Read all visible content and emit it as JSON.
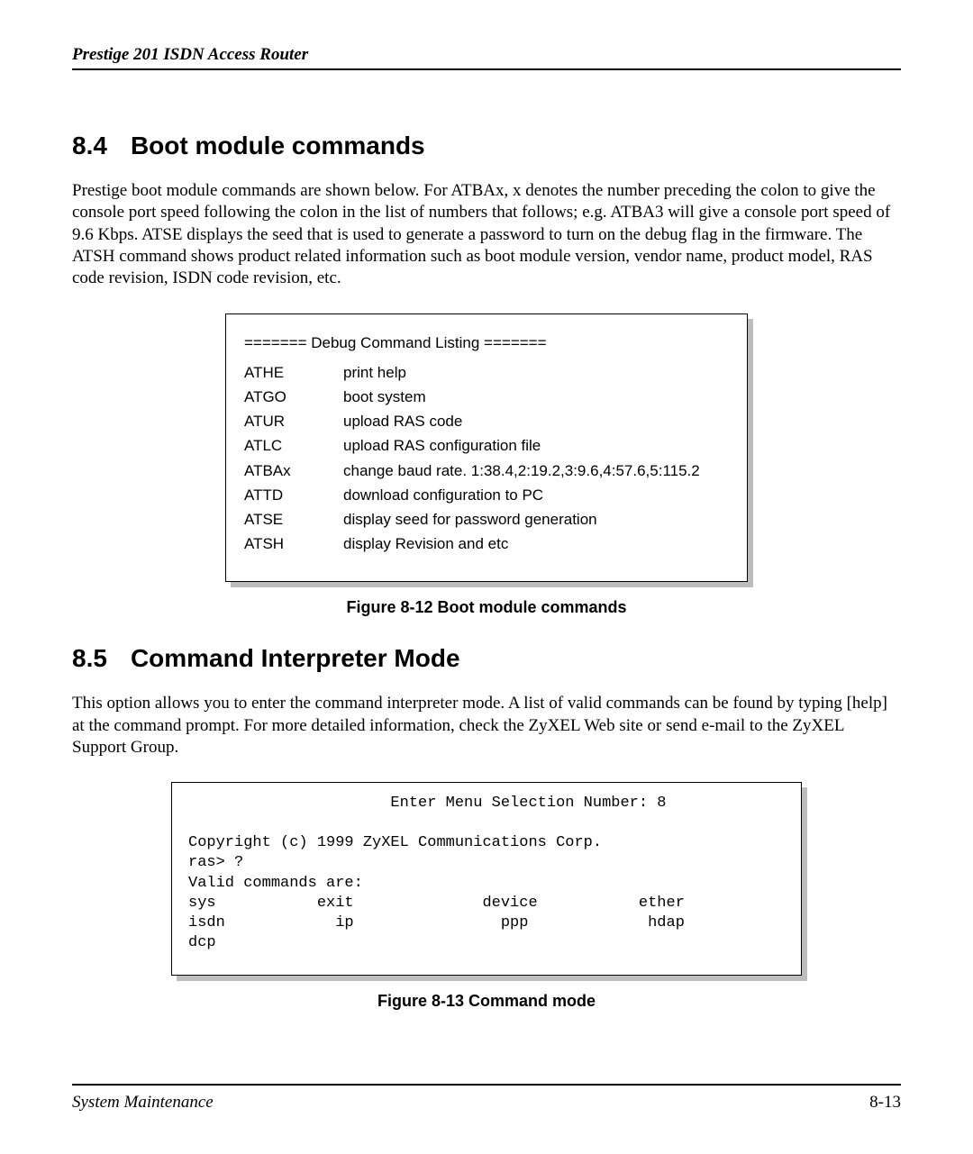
{
  "header": {
    "running": "Prestige 201 ISDN Access Router"
  },
  "section_84": {
    "number": "8.4",
    "title": "Boot module commands",
    "paragraph": "Prestige boot module commands are shown below. For ATBAx, x denotes the number preceding the colon to give the console port speed following the colon in the list of numbers that follows; e.g. ATBA3 will give a console port speed of 9.6 Kbps.  ATSE displays the seed that is used to generate a password to turn on the debug flag in the firmware. The ATSH command shows product related information such as boot module version, vendor name, product model, RAS code revision, ISDN code revision, etc."
  },
  "figure_812": {
    "title": "======= Debug Command Listing =======",
    "rows": [
      {
        "cmd": "ATHE",
        "desc": "print help"
      },
      {
        "cmd": "ATGO",
        "desc": "boot system"
      },
      {
        "cmd": "ATUR",
        "desc": "upload RAS code"
      },
      {
        "cmd": "ATLC",
        "desc": "upload RAS configuration file"
      },
      {
        "cmd": "ATBAx",
        "desc": "change baud rate. 1:38.4,2:19.2,3:9.6,4:57.6,5:115.2"
      },
      {
        "cmd": "ATTD",
        "desc": "download configuration to PC"
      },
      {
        "cmd": "ATSE",
        "desc": "display seed for password generation"
      },
      {
        "cmd": "ATSH",
        "desc": "display Revision and etc"
      }
    ],
    "caption": "Figure 8-12 Boot module commands"
  },
  "section_85": {
    "number": "8.5",
    "title": "Command Interpreter Mode",
    "paragraph": "This option allows you to enter the command interpreter mode. A list of valid commands can be found by typing [help] at the command prompt. For more detailed information, check the ZyXEL Web site or send e-mail to the ZyXEL Support Group."
  },
  "figure_813": {
    "terminal": "                      Enter Menu Selection Number: 8\n\nCopyright (c) 1999 ZyXEL Communications Corp.\nras> ?\nValid commands are:\nsys           exit              device           ether\nisdn            ip                ppp             hdap\ndcp",
    "caption": "Figure 8-13 Command mode"
  },
  "footer": {
    "left": "System Maintenance",
    "right": "8-13"
  }
}
